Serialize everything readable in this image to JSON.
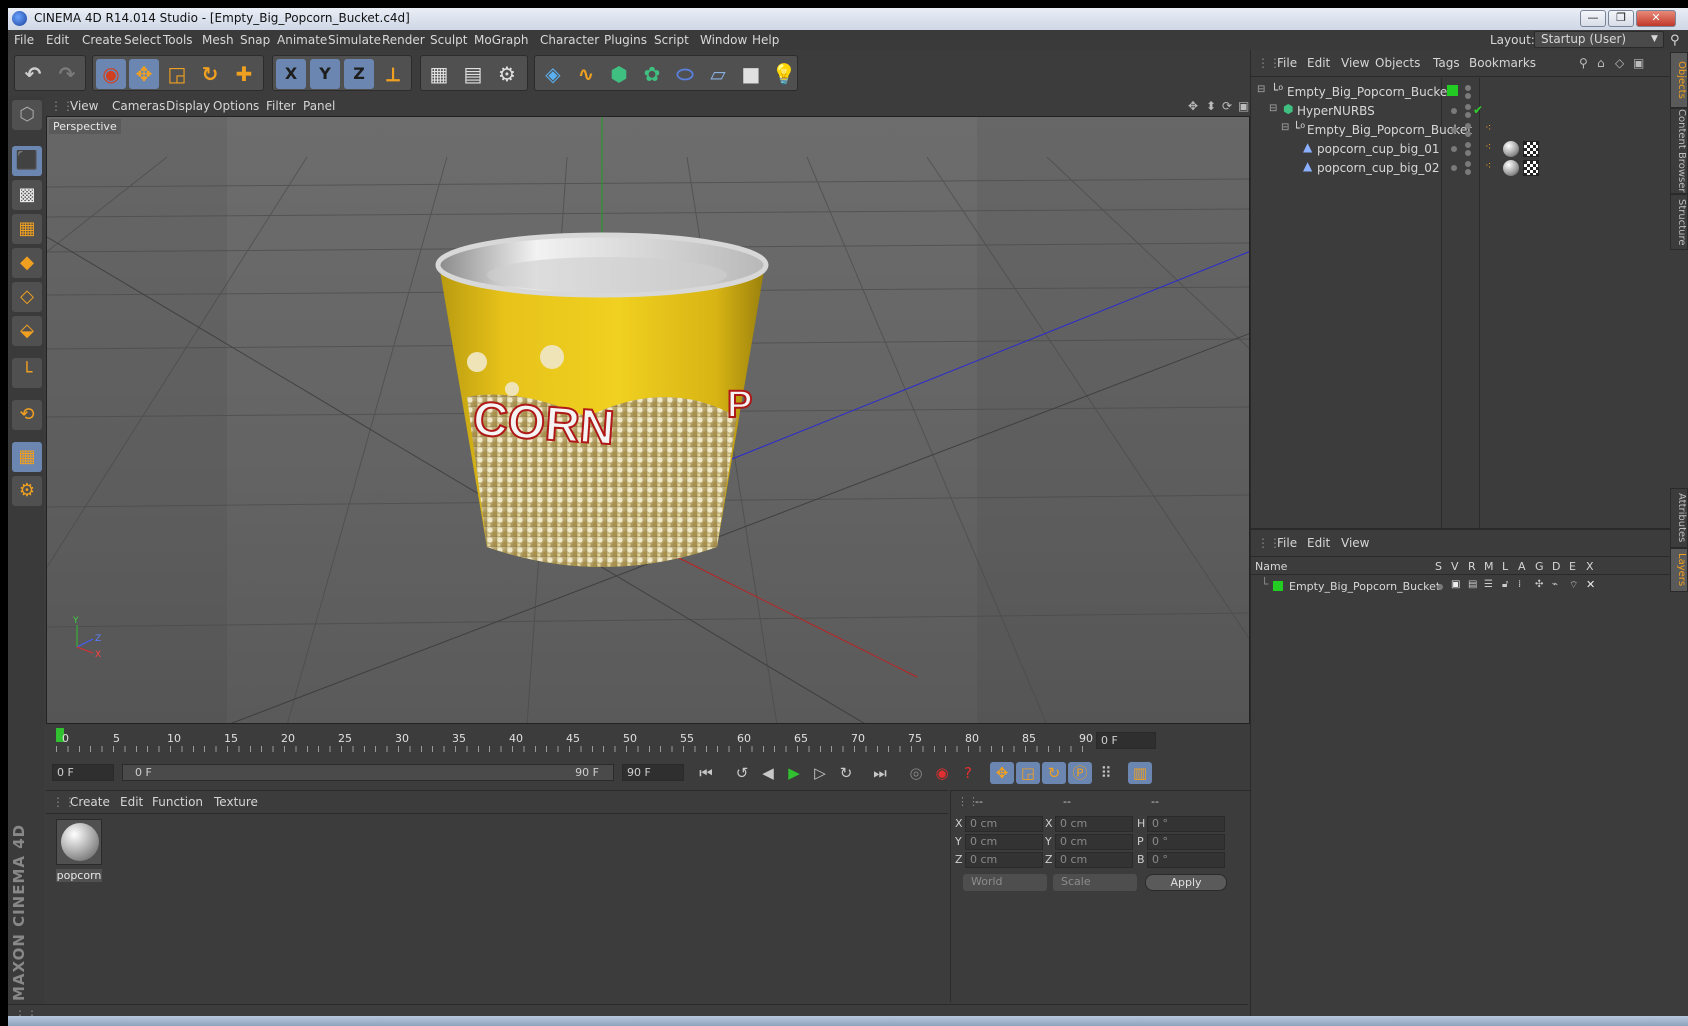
{
  "window": {
    "title": "CINEMA 4D R14.014 Studio - [Empty_Big_Popcorn_Bucket.c4d]",
    "min_glyph": "—",
    "max_glyph": "❐",
    "close_glyph": "✕"
  },
  "menubar": {
    "items": [
      "File",
      "Edit",
      "Create",
      "Select",
      "Tools",
      "Mesh",
      "Snap",
      "Animate",
      "Simulate",
      "Render",
      "Sculpt",
      "MoGraph",
      "Character",
      "Plugins",
      "Script",
      "Window",
      "Help"
    ],
    "layout_label": "Layout:",
    "layout_value": "Startup (User)"
  },
  "toolbar": {
    "icons": [
      "undo-icon",
      "redo-icon",
      "live-selection-icon",
      "move-icon",
      "scale-icon",
      "rotate-icon",
      "add-icon",
      "x-axis-icon",
      "y-axis-icon",
      "z-axis-icon",
      "coordinate-system-icon",
      "render-view-icon",
      "render-picture-viewer-icon",
      "render-settings-icon",
      "cube-icon",
      "spline-icon",
      "nurbs-icon",
      "array-icon",
      "deformer-icon",
      "floor-icon",
      "camera-icon",
      "light-icon"
    ],
    "axis_x": "X",
    "axis_y": "Y",
    "axis_z": "Z"
  },
  "viewport": {
    "menu": [
      "View",
      "Cameras",
      "Display",
      "Options",
      "Filter",
      "Panel"
    ],
    "label": "Perspective",
    "axis_y": "Y",
    "axis_z": "Z",
    "axis_x": "X",
    "cup_text": "CORN",
    "cup_text_right": "P"
  },
  "timeline": {
    "ticks": [
      "0",
      "5",
      "10",
      "15",
      "20",
      "25",
      "30",
      "35",
      "40",
      "45",
      "50",
      "55",
      "60",
      "65",
      "70",
      "75",
      "80",
      "85",
      "90"
    ],
    "current_frame": "0 F",
    "start_frame": "0 F",
    "range_start": "0 F",
    "range_end": "90 F",
    "end_frame": "90 F"
  },
  "materials": {
    "menu": [
      "Create",
      "Edit",
      "Function",
      "Texture"
    ],
    "items": [
      {
        "name": "popcorn"
      }
    ]
  },
  "coordinates": {
    "headers": [
      "--",
      "--",
      "--"
    ],
    "pos_labels": [
      "X",
      "Y",
      "Z"
    ],
    "size_labels": [
      "X",
      "Y",
      "Z"
    ],
    "rot_labels": [
      "H",
      "P",
      "B"
    ],
    "pos_values": [
      "0 cm",
      "0 cm",
      "0 cm"
    ],
    "size_values": [
      "0 cm",
      "0 cm",
      "0 cm"
    ],
    "rot_values": [
      "0 °",
      "0 °",
      "0 °"
    ],
    "mode": "World",
    "size_mode": "Scale",
    "apply": "Apply"
  },
  "object_manager": {
    "menu": [
      "File",
      "Edit",
      "View",
      "Objects",
      "Tags",
      "Bookmarks"
    ],
    "objects": [
      {
        "name": "Empty_Big_Popcorn_Bucket"
      },
      {
        "name": "HyperNURBS"
      },
      {
        "name": "Empty_Big_Popcorn_Bucket"
      },
      {
        "name": "popcorn_cup_big_01"
      },
      {
        "name": "popcorn_cup_big_02"
      }
    ]
  },
  "layer_manager": {
    "menu": [
      "File",
      "Edit",
      "View"
    ],
    "columns": [
      "Name",
      "S",
      "V",
      "R",
      "M",
      "L",
      "A",
      "G",
      "D",
      "E",
      "X"
    ],
    "layers": [
      {
        "name": "Empty_Big_Popcorn_Bucket"
      }
    ]
  },
  "side_tabs": [
    "Objects",
    "Content Browser",
    "Structure",
    "Attributes",
    "Layers"
  ],
  "brand": "MAXON CINEMA 4D",
  "colors": {
    "accent": "#f0a020",
    "selected": "#6b86b0",
    "layer_green": "#22cc22",
    "cup_yellow": "#e8c31a"
  }
}
